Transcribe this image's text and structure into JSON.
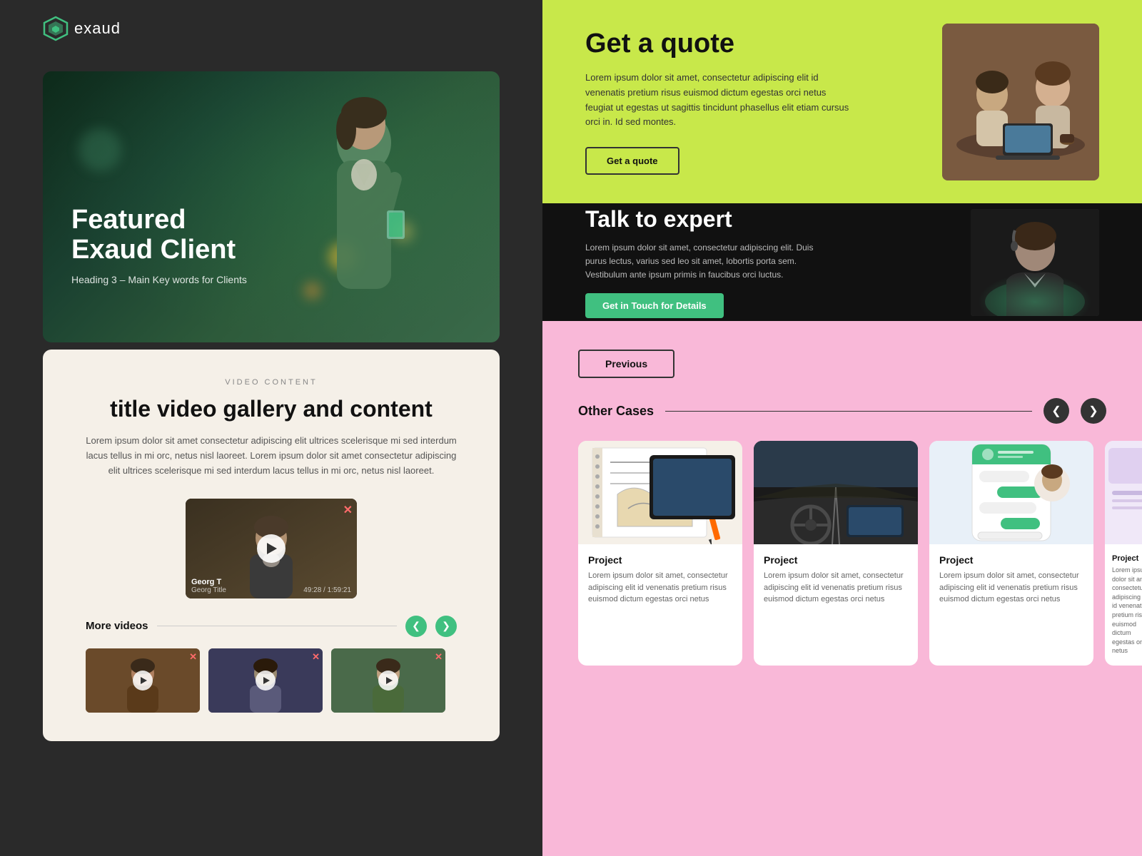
{
  "app": {
    "name": "exaud"
  },
  "left_panel": {
    "hero": {
      "title": "Featured Exaud Client",
      "subtitle": "Heading 3 – Main Key words for Clients"
    },
    "video_section": {
      "label": "VIDEO CONTENT",
      "title": "title video gallery and content",
      "description": "Lorem ipsum dolor sit amet consectetur adipiscing elit ultrices scelerisque mi sed interdum lacus tellus in mi orc, netus nisl laoreet. Lorem ipsum dolor sit amet consectetur adipiscing elit ultrices scelerisque mi sed interdum lacus tellus in mi orc, netus nisl laoreet.",
      "video": {
        "person_name": "Georg T",
        "person_role": "Georg Title",
        "time_current": "49:28",
        "time_total": "1:59:21"
      },
      "more_videos_label": "More videos",
      "prev_btn": "❮",
      "next_btn": "❯"
    }
  },
  "right_panel": {
    "quote_section": {
      "title": "Get a quote",
      "description": "Lorem ipsum dolor sit amet, consectetur adipiscing elit id venenatis pretium risus euismod dictum egestas orci netus feugiat ut egestas ut sagittis tincidunt phasellus elit etiam cursus orci in. Id sed montes.",
      "button_label": "Get a quote"
    },
    "expert_section": {
      "title": "Talk to expert",
      "description": "Lorem ipsum dolor sit amet, consectetur adipiscing elit. Duis purus lectus, varius sed leo sit amet, lobortis porta sem. Vestibulum ante ipsum primis in faucibus orci luctus.",
      "button_label": "Get in Touch for Details"
    },
    "cases_section": {
      "previous_btn": "Previous",
      "other_cases_label": "Other Cases",
      "projects": [
        {
          "title": "Project",
          "description": "Lorem ipsum dolor sit amet, consectetur adipiscing elit id venenatis pretium risus euismod dictum egestas orci netus",
          "type": "notebook"
        },
        {
          "title": "Project",
          "description": "Lorem ipsum dolor sit amet, consectetur adipiscing elit id venenatis pretium risus euismod dictum egestas orci netus",
          "type": "car"
        },
        {
          "title": "Project",
          "description": "Lorem ipsum dolor sit amet, consectetur adipiscing elit id venenatis pretium risus euismod dictum egestas orci netus",
          "type": "chat"
        },
        {
          "title": "Project",
          "description": "Lorem ipsum dolor sit amet, consectetur adipiscing elit id venenatis pretium risus euismod dictum egestas orci netus",
          "type": "partial"
        }
      ]
    }
  }
}
